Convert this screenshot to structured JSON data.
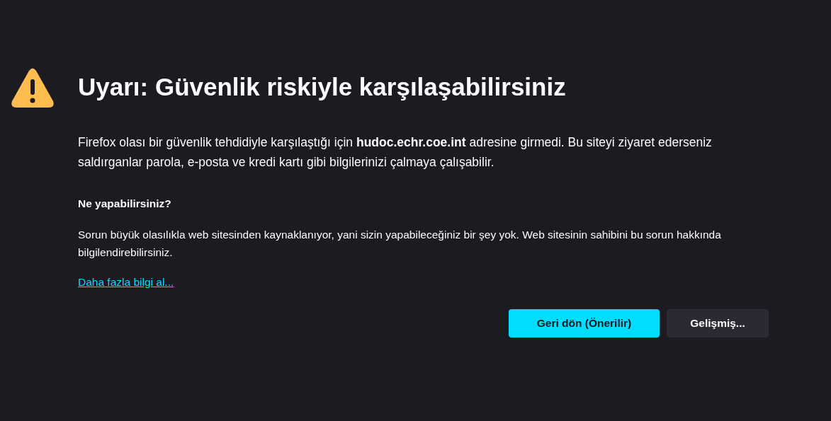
{
  "title": "Uyarı: Güvenlik riskiyle karşılaşabilirsiniz",
  "description": "Firefox olası bir güvenlik tehdidiyle karşılaştığı için **hudoc.echr.coe.int** adresine girmedi. Bu siteyi ziyaret ederseniz saldırganlar parola, e-posta ve kredi kartı gibi bilgilerinizi çalmaya çalışabilir.",
  "subheading": "Ne yapabilirsiniz?",
  "explanation": "Sorun büyük olasılıkla web sitesinden kaynaklanıyor, yani sizin yapabileceğiniz bir şey yok. Web sitesinin sahibini bu sorun hakkında bilgilendirebilirsiniz.",
  "link": "Daha fazla bilgi al...",
  "buttons": [
    {
      "label": "Geri dön (Önerilir)",
      "kind": "primary"
    },
    {
      "label": "Gelişmiş...",
      "kind": "secondary"
    }
  ]
}
